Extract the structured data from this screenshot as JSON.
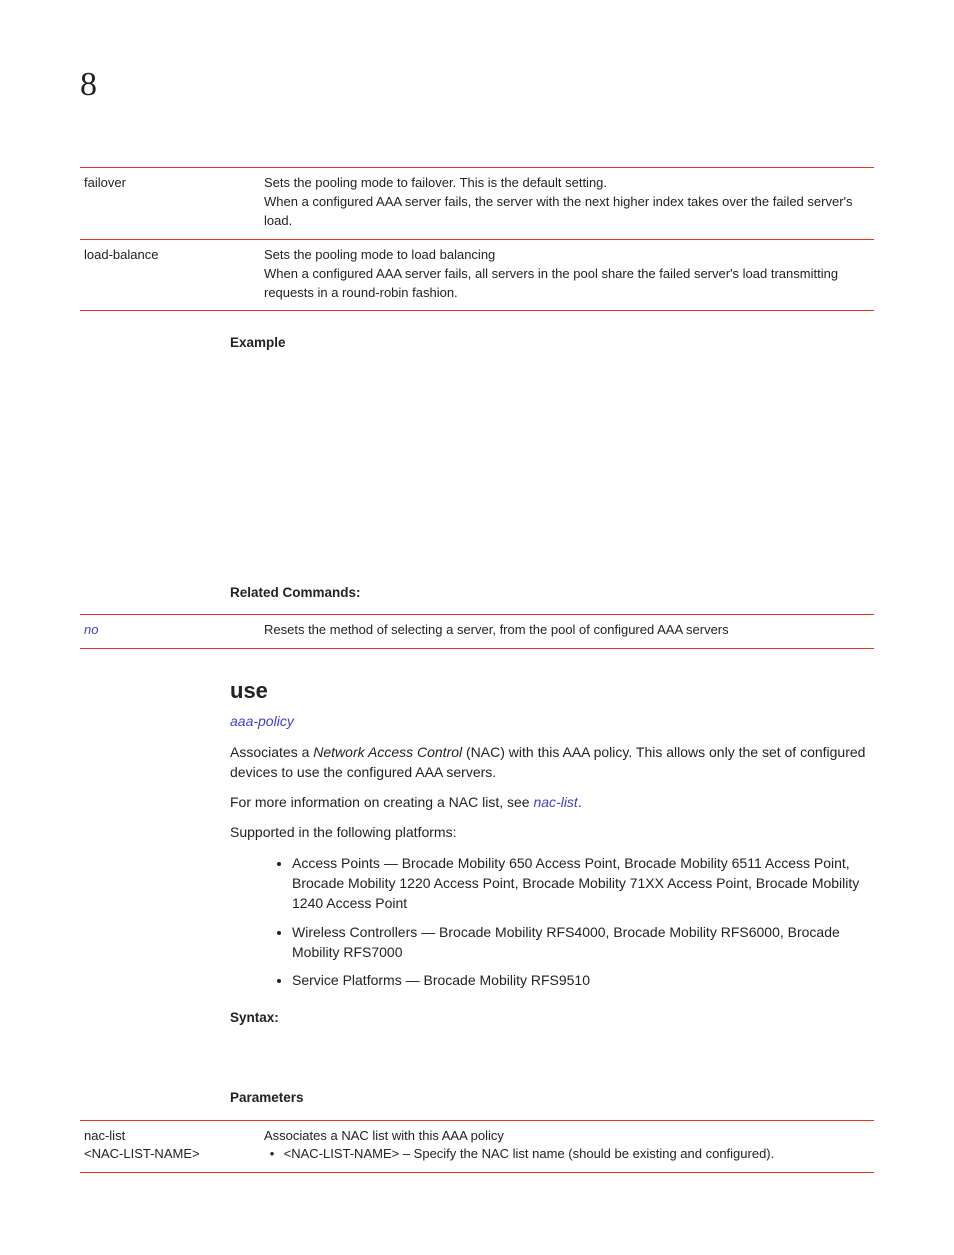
{
  "chapter": "8",
  "poolTable": [
    {
      "name": "failover",
      "line1": "Sets the pooling mode to failover. This is the default setting.",
      "line2": "When a configured AAA server fails, the server with the next higher index takes over the failed server's load."
    },
    {
      "name": "load-balance",
      "line1": "Sets the pooling mode to load balancing",
      "line2": "When a configured AAA server fails, all servers in the pool share the failed server's load transmitting requests in a round-robin fashion."
    }
  ],
  "labels": {
    "example": "Example",
    "related": "Related Commands:",
    "syntax": "Syntax:",
    "parameters": "Parameters"
  },
  "related": {
    "key": "no",
    "desc": "Resets the method of selecting a server, from the pool of configured AAA servers"
  },
  "use": {
    "title": "use",
    "policyLink": "aaa-policy",
    "assoc": {
      "pre": "Associates a ",
      "em": "Network Access Control",
      "post": " (NAC) with this AAA policy. This allows only the set of configured devices to use the configured AAA servers."
    },
    "moreInfoPre": "For more information on creating a NAC list, see ",
    "moreInfoLink": "nac-list",
    "supported": "Supported in the following platforms:",
    "bullets": [
      "Access Points — Brocade Mobility 650 Access Point, Brocade Mobility 6511 Access Point, Brocade Mobility 1220 Access Point, Brocade Mobility 71XX Access Point, Brocade Mobility 1240 Access Point",
      "Wireless Controllers — Brocade Mobility RFS4000, Brocade Mobility RFS6000, Brocade Mobility RFS7000",
      "Service Platforms — Brocade Mobility RFS9510"
    ]
  },
  "paramsTable": {
    "key1": "nac-list",
    "key2": "<NAC-LIST-NAME>",
    "desc": "Associates a NAC list with this AAA policy",
    "bulletLine": "<NAC-LIST-NAME> – Specify the NAC list name (should be existing and configured)."
  }
}
